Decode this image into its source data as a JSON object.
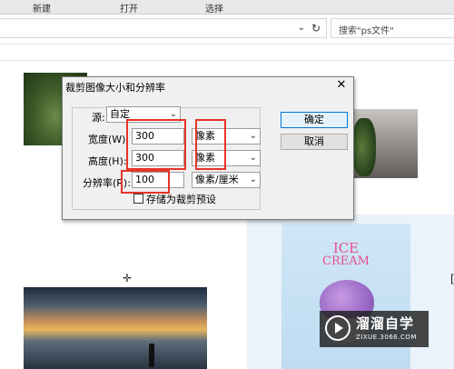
{
  "topbar": {
    "menu": [
      "新建",
      "打开",
      "选择"
    ]
  },
  "search": {
    "placeholder": "搜索\"ps文件\""
  },
  "ice_card": {
    "line1": "ICE",
    "line2": "CREAM"
  },
  "watermark": {
    "name": "溜溜自学",
    "site": "ZIXUE.3066.COM"
  },
  "dialog": {
    "title": "裁剪图像大小和分辨率",
    "source_label": "源:",
    "source_value": "自定",
    "width_label": "宽度(W):",
    "width_value": "300",
    "width_unit": "像素",
    "height_label": "高度(H):",
    "height_value": "300",
    "height_unit": "像素",
    "resolution_label": "分辨率(R):",
    "resolution_value": "100",
    "resolution_unit": "像素/厘米",
    "save_preset_label": "存储为裁剪预设",
    "ok_label": "确定",
    "cancel_label": "取消"
  },
  "colors": {
    "highlight": "#e5342a",
    "selection_panel": "#eaf3fc",
    "ok_border": "#0078d7"
  },
  "icons": [
    "chevron-down-icon",
    "refresh-icon",
    "close-icon",
    "play-logo-icon",
    "crosshair-cursor-icon"
  ]
}
